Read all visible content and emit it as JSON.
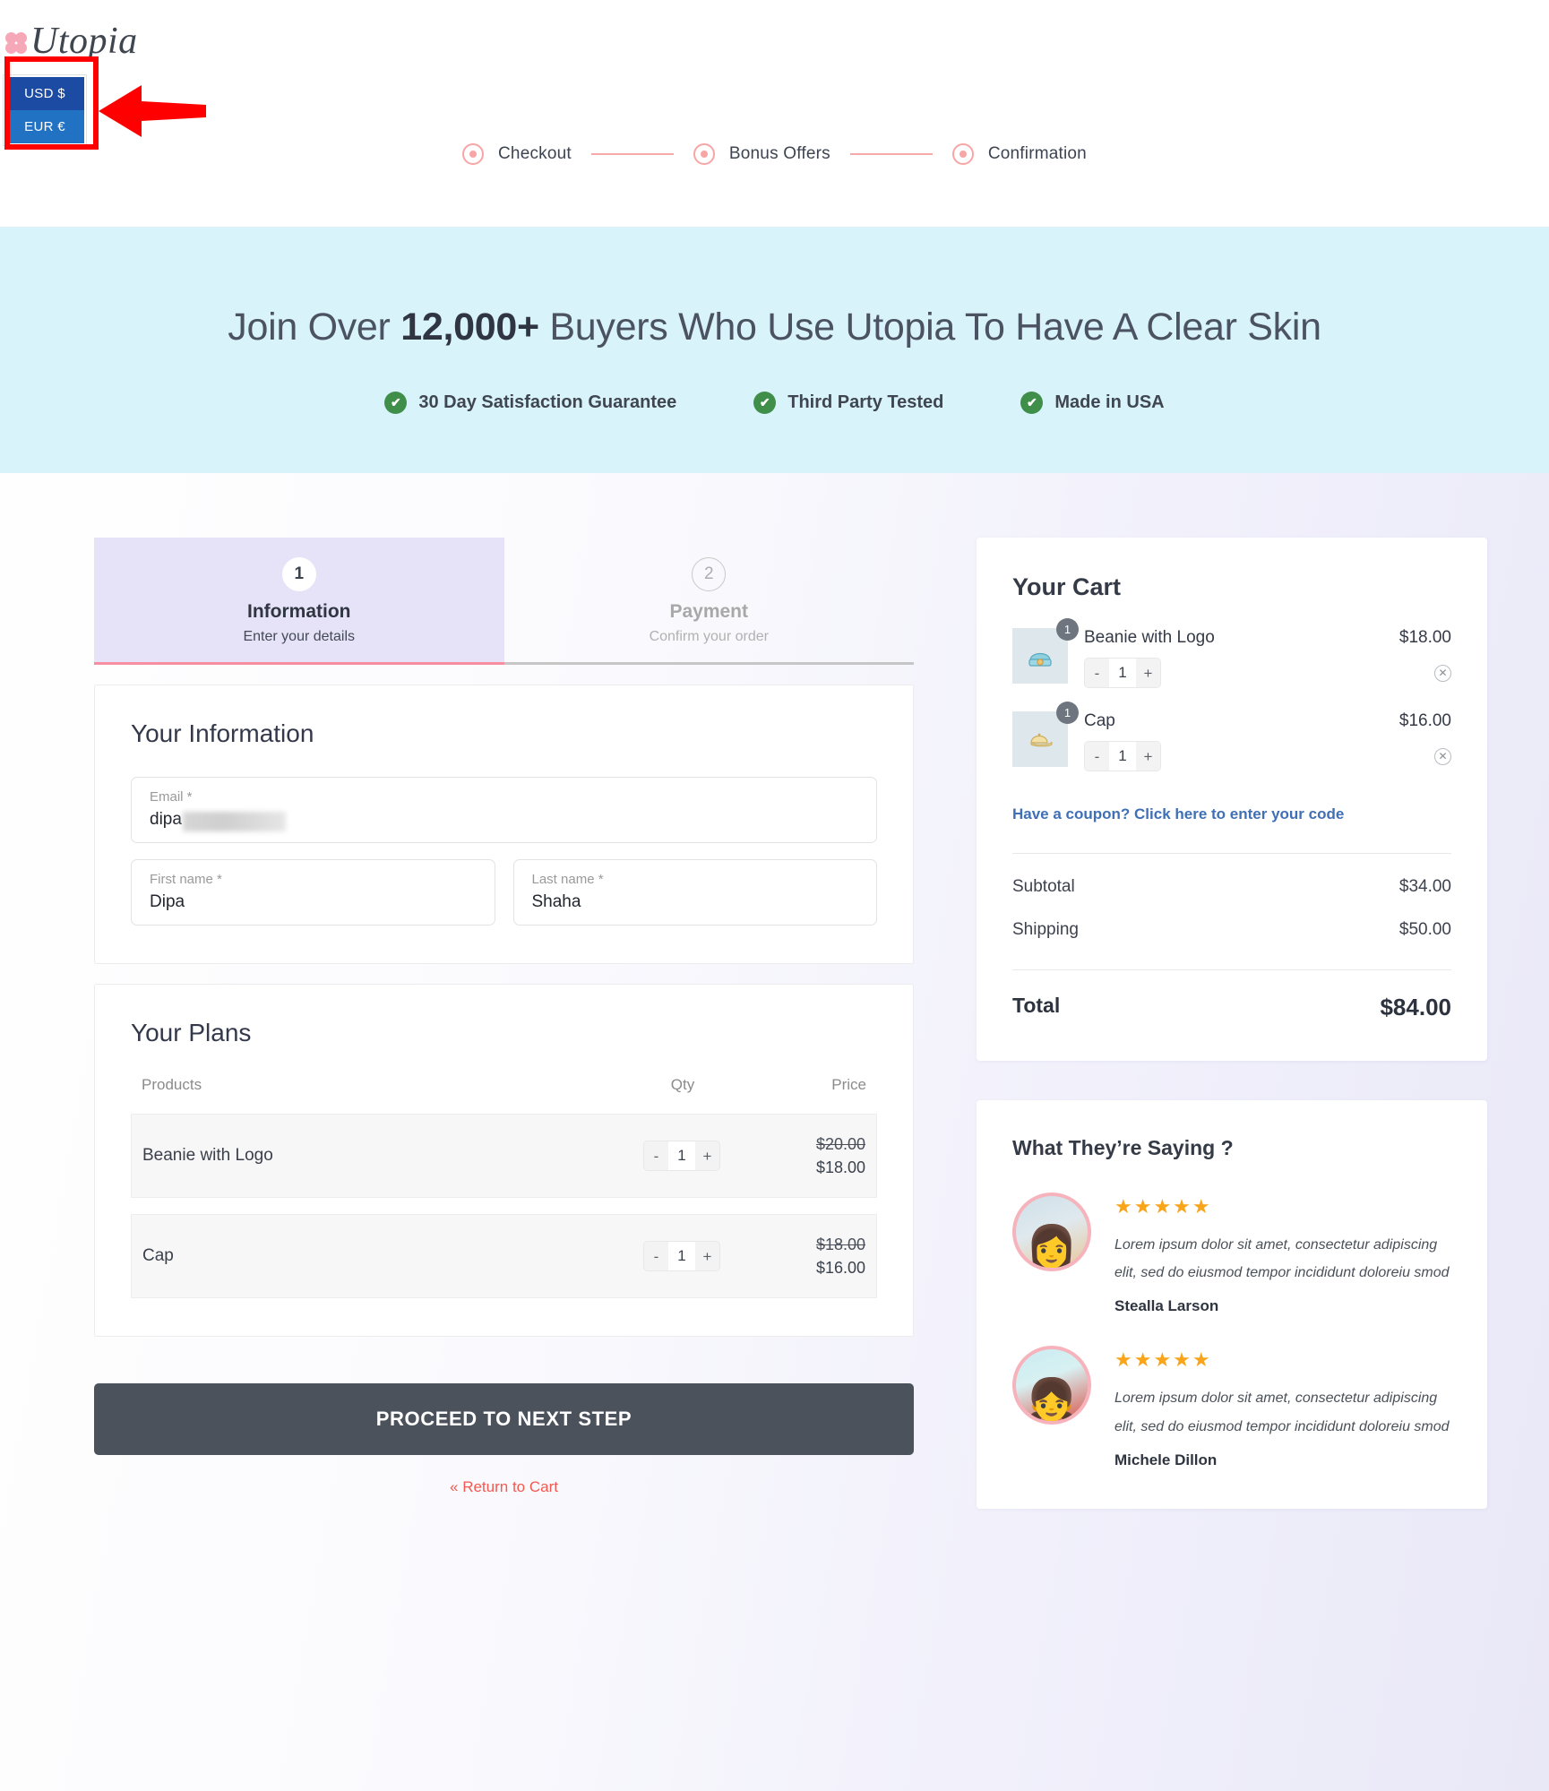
{
  "brand": {
    "name": "Utopia",
    "flower_icon": "flower-icon"
  },
  "currency_selector": {
    "selected": "USD $",
    "options": [
      "USD $",
      "EUR €"
    ],
    "highlight_color": "#ff0000",
    "selected_bg": "#1b4ba3",
    "option_bg": "#2272c4"
  },
  "progress_steps": [
    {
      "label": "Checkout"
    },
    {
      "label": "Bonus Offers"
    },
    {
      "label": "Confirmation"
    }
  ],
  "hero": {
    "headline_prefix": "Join Over ",
    "headline_highlight": "12,000+",
    "headline_suffix": " Buyers Who Use Utopia To Have A Clear Skin",
    "badges": [
      {
        "label": "30 Day Satisfaction Guarantee",
        "icon": "check-circle-icon"
      },
      {
        "label": "Third Party Tested",
        "icon": "check-circle-icon"
      },
      {
        "label": "Made in USA",
        "icon": "check-circle-icon"
      }
    ],
    "bg_color": "#d9f3fb",
    "badge_color": "#3f8f4b"
  },
  "tabs": [
    {
      "number": "1",
      "title": "Information",
      "subtitle": "Enter your details",
      "state": "active"
    },
    {
      "number": "2",
      "title": "Payment",
      "subtitle": "Confirm your order",
      "state": "inactive"
    }
  ],
  "information": {
    "heading": "Your Information",
    "email": {
      "label": "Email *",
      "value": "dipa",
      "redacted": true
    },
    "first_name": {
      "label": "First name *",
      "value": "Dipa"
    },
    "last_name": {
      "label": "Last name *",
      "value": "Shaha"
    }
  },
  "plans": {
    "heading": "Your Plans",
    "columns": [
      "Products",
      "Qty",
      "Price"
    ],
    "rows": [
      {
        "name": "Beanie with Logo",
        "qty": "1",
        "old_price": "$20.00",
        "price": "$18.00",
        "minus": "-",
        "plus": "+"
      },
      {
        "name": "Cap",
        "qty": "1",
        "old_price": "$18.00",
        "price": "$16.00",
        "minus": "-",
        "plus": "+"
      }
    ]
  },
  "actions": {
    "proceed_label": "PROCEED TO NEXT STEP",
    "return_label": "« Return to Cart"
  },
  "cart": {
    "heading": "Your Cart",
    "items": [
      {
        "name": "Beanie with Logo",
        "price": "$18.00",
        "qty": "1",
        "badge": "1",
        "minus": "-",
        "plus": "+",
        "thumb_icon": "beanie-icon",
        "thumb_glyph": "🧢"
      },
      {
        "name": "Cap",
        "price": "$16.00",
        "qty": "1",
        "badge": "1",
        "minus": "-",
        "plus": "+",
        "thumb_icon": "cap-icon",
        "thumb_glyph": "🧢"
      }
    ],
    "coupon_link": "Have a coupon? Click here to enter your code",
    "coupon_color": "#3f6fb5",
    "summary": [
      {
        "label": "Subtotal",
        "value": "$34.00"
      },
      {
        "label": "Shipping",
        "value": "$50.00"
      }
    ],
    "total": {
      "label": "Total",
      "value": "$84.00"
    }
  },
  "reviews": {
    "heading": "What They’re Saying ?",
    "star_color": "#f9a51b",
    "items": [
      {
        "stars": "★★★★★",
        "text": "Lorem ipsum dolor sit amet, consectetur adipiscing elit, sed do eiusmod tempor incididunt doloreiu smod",
        "name": "Stealla Larson",
        "avatar_icon": "avatar-woman-sunglasses"
      },
      {
        "stars": "★★★★★",
        "text": "Lorem ipsum dolor sit amet, consectetur adipiscing elit, sed do eiusmod tempor incididunt doloreiu smod",
        "name": "Michele Dillon",
        "avatar_icon": "avatar-woman-red-jacket"
      }
    ]
  }
}
